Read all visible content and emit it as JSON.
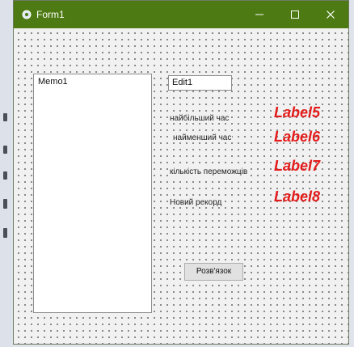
{
  "window": {
    "title": "Form1"
  },
  "form": {
    "memo_text": "Memo1",
    "edit_text": "Edit1",
    "labels": {
      "max_time": "найбільший час",
      "min_time": "найменший час",
      "winner_count": "кількість переможців",
      "new_record": "Новий рекорд"
    },
    "red_labels": {
      "label5": "Label5",
      "label6": "Label6",
      "label7": "Label7",
      "label8": "Label8"
    },
    "button_label": "Розв'язок"
  },
  "icons": {
    "app": "app-icon",
    "minimize": "minimize-icon",
    "maximize": "maximize-icon",
    "close": "close-icon"
  },
  "colors": {
    "titlebar": "#4d7a12",
    "red_label": "#e41b1b"
  }
}
